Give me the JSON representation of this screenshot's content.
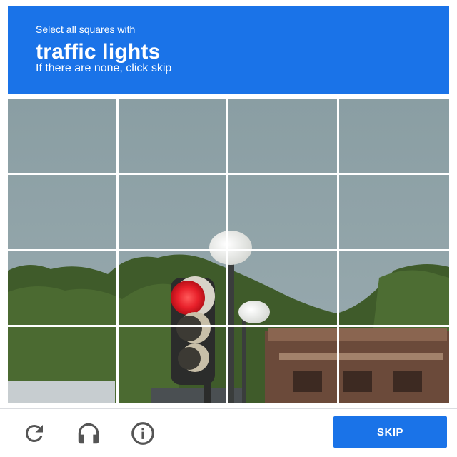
{
  "header": {
    "instruction": "Select all squares with",
    "target": "traffic lights",
    "hint": "If there are none, click skip"
  },
  "grid": {
    "rows": 4,
    "columns": 4
  },
  "footer": {
    "icons": [
      "reload-icon",
      "headphones-icon",
      "info-icon"
    ],
    "skip_label": "SKIP"
  },
  "colors": {
    "accent": "#1a73e8",
    "sky": "#8a9ea3",
    "foliage": "#3f5b2a",
    "signal_red": "#e8202a"
  }
}
